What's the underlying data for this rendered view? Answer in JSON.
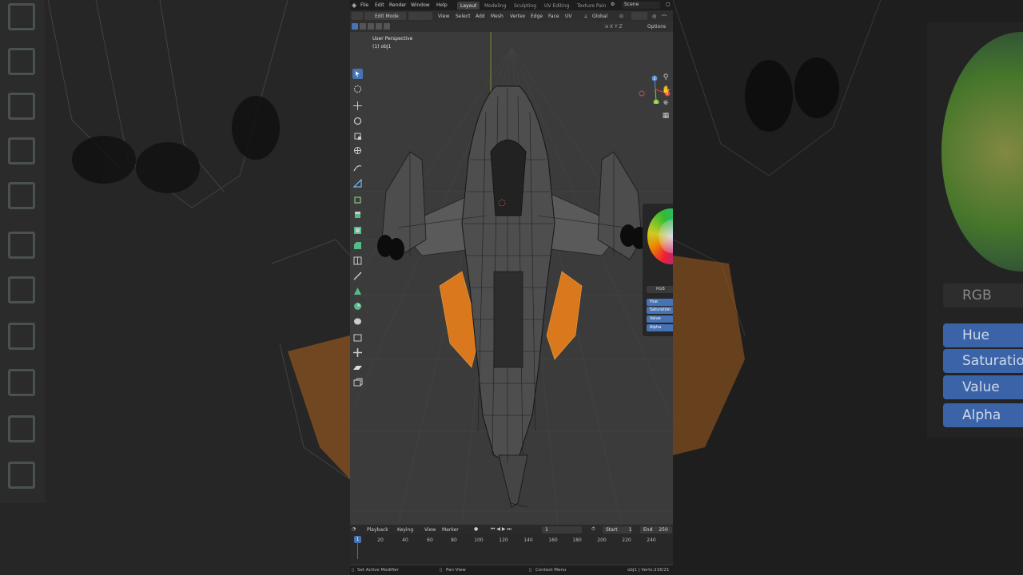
{
  "topbar": {
    "menus": [
      "File",
      "Edit",
      "Render",
      "Window",
      "Help"
    ],
    "workspace_tabs": [
      {
        "label": "Layout",
        "active": true
      },
      {
        "label": "Modeling",
        "active": false
      },
      {
        "label": "Sculpting",
        "active": false
      },
      {
        "label": "UV Editing",
        "active": false
      },
      {
        "label": "Texture Pain",
        "active": false
      }
    ],
    "scene": "Scene"
  },
  "header": {
    "mode": "Edit Mode",
    "menus": [
      "View",
      "Select",
      "Add",
      "Mesh",
      "Vertex",
      "Edge",
      "Face",
      "UV"
    ],
    "orientation": "Global",
    "options": "Options"
  },
  "viewport": {
    "view_name": "User Perspective",
    "object_name": "(1) obj1"
  },
  "gizmo": {
    "z": "Z",
    "x": "X",
    "y": "Y"
  },
  "color_picker": {
    "mode": "RGB",
    "fields": [
      "Hue",
      "Saturation",
      "Value",
      "Alpha"
    ]
  },
  "backdrop": {
    "mode": "RGB",
    "fields": [
      "Hue",
      "Saturation",
      "Value",
      "Alpha"
    ]
  },
  "timeline": {
    "menus": [
      "Playback",
      "Keying",
      "View",
      "Marker"
    ],
    "current_frame": "1",
    "start_label": "Start",
    "start": "1",
    "end_label": "End",
    "end": "250",
    "ticks": [
      "1",
      "20",
      "40",
      "60",
      "80",
      "100",
      "120",
      "140",
      "160",
      "180",
      "200",
      "220",
      "240"
    ]
  },
  "statusbar": {
    "left": "Set Active Modifier",
    "middle": "Pan View",
    "right": "Context Menu",
    "stats": "obj1 | Verts:216/21"
  },
  "colors": {
    "accent": "#4772b3",
    "mesh_highlight": "#e0821f",
    "background": "#3b3b3b"
  }
}
